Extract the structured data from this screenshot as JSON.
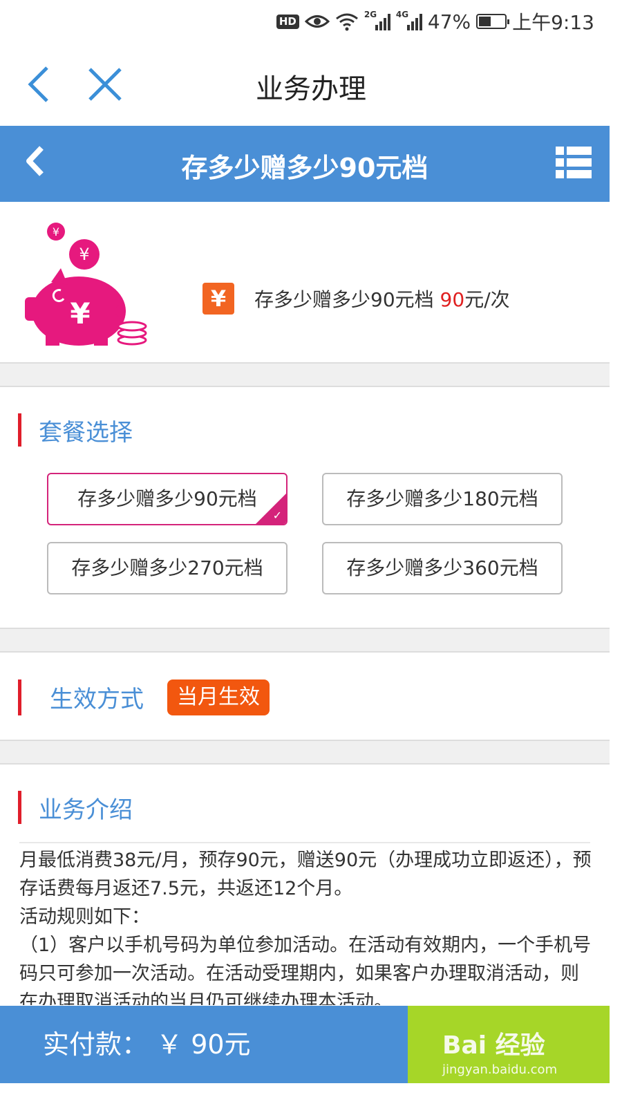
{
  "status_bar": {
    "hd": "HD",
    "net1": "2G",
    "net2": "4G",
    "battery_percent": "47%",
    "battery_level": 0.47,
    "time": "上午9:13"
  },
  "app_header": {
    "title": "业务办理"
  },
  "page_header": {
    "title": "存多少赠多少90元档"
  },
  "product": {
    "yuan_symbol": "¥",
    "name": "存多少赠多少90元档",
    "price": "90",
    "unit": "元/次"
  },
  "package_section": {
    "title": "套餐选择",
    "options": [
      {
        "label": "存多少赠多少90元档",
        "selected": true
      },
      {
        "label": "存多少赠多少180元档",
        "selected": false
      },
      {
        "label": "存多少赠多少270元档",
        "selected": false
      },
      {
        "label": "存多少赠多少360元档",
        "selected": false
      }
    ]
  },
  "effect_section": {
    "title": "生效方式",
    "value": "当月生效"
  },
  "intro_section": {
    "title": "业务介绍",
    "lines": [
      "月最低消费38元/月，预存90元，赠送90元（办理成功立即返还），预存话费每月返还7.5元，共返还12个月。",
      "活动规则如下：",
      "（1）客户以手机号码为单位参加活动。在活动有效期内，一个手机号码只可参加一次活动。在活动受理期内，如果客户办理取消活动，则在办理取消活动的当月仍可继续办理本活动。"
    ]
  },
  "bottom_bar": {
    "pay_label": "实付款：",
    "pay_amount": "￥ 90元"
  },
  "watermark": {
    "main": "Bai 经验",
    "sub": "jingyan.baidu.com"
  },
  "colors": {
    "header_blue": "#4a8fd6",
    "accent_pink": "#d4237a",
    "accent_orange": "#f2570f",
    "section_red": "#e01e2b",
    "submit_green": "#a6d628"
  }
}
